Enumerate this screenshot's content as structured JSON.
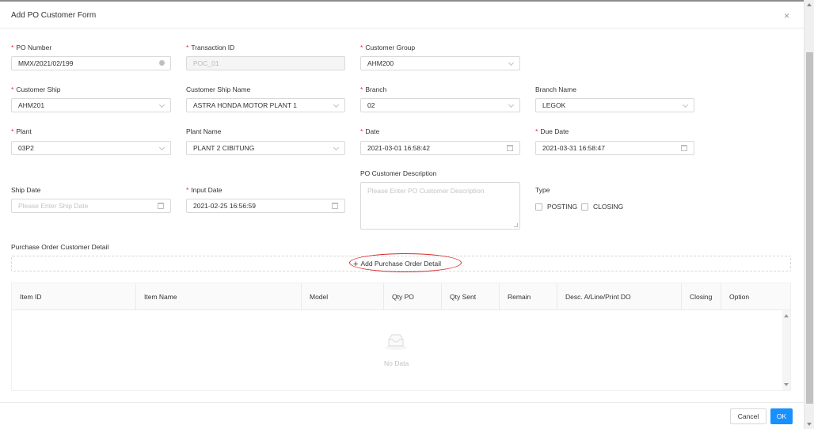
{
  "window": {
    "title": "Add PO Customer Form"
  },
  "required_mark": "*",
  "form": {
    "po_number": {
      "label": "PO Number",
      "value": "MMX/2021/02/199"
    },
    "transaction_id": {
      "label": "Transaction ID",
      "value": "POC_01"
    },
    "customer_group": {
      "label": "Customer Group",
      "value": "AHM200"
    },
    "customer_ship": {
      "label": "Customer Ship",
      "value": "AHM201"
    },
    "customer_ship_name": {
      "label": "Customer Ship Name",
      "value": "ASTRA HONDA MOTOR PLANT 1"
    },
    "branch": {
      "label": "Branch",
      "value": "02"
    },
    "branch_name": {
      "label": "Branch Name",
      "value": "LEGOK"
    },
    "plant": {
      "label": "Plant",
      "value": "03P2"
    },
    "plant_name": {
      "label": "Plant Name",
      "value": "PLANT 2 CIBITUNG"
    },
    "date": {
      "label": "Date",
      "value": "2021-03-01 16:58:42"
    },
    "due_date": {
      "label": "Due Date",
      "value": "2021-03-31 16:58:47"
    },
    "ship_date": {
      "label": "Ship Date",
      "placeholder": "Please Enter Ship Date"
    },
    "input_date": {
      "label": "Input Date",
      "value": "2021-02-25 16:56:59"
    },
    "po_customer_description": {
      "label": "PO Customer Description",
      "placeholder": "Please Enter PO Customer Description"
    },
    "type": {
      "label": "Type",
      "options": [
        "POSTING",
        "CLOSING"
      ]
    }
  },
  "detail": {
    "section_label": "Purchase Order Customer Detail",
    "add_button": "Add Purchase Order Detail",
    "add_icon": "+",
    "columns": [
      "Item ID",
      "Item Name",
      "Model",
      "Qty PO",
      "Qty Sent",
      "Remain",
      "Desc. A/Line/Print DO",
      "Closing",
      "Option"
    ],
    "empty_text": "No Data"
  },
  "icons": {
    "close": "×"
  },
  "footer": {
    "cancel": "Cancel",
    "ok": "OK"
  },
  "colors": {
    "primary": "#1890ff",
    "required": "#f5222d",
    "highlight_ellipse": "#d62d2d"
  }
}
